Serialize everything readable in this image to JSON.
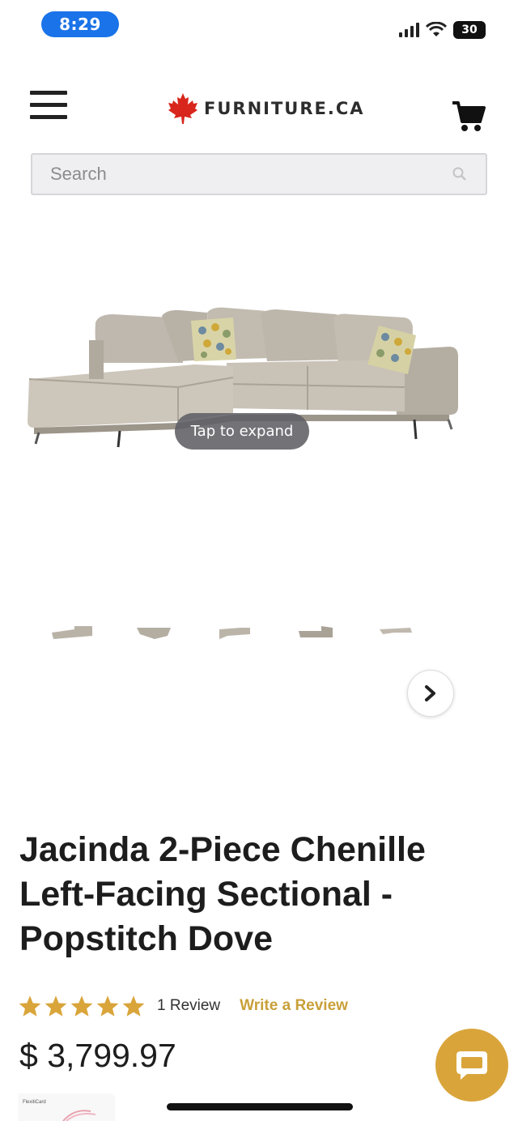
{
  "status_bar": {
    "time": "8:29",
    "battery": "30"
  },
  "header": {
    "brand_name": "FURNITURE.CA",
    "icons": [
      "menu-icon",
      "maple-leaf-icon",
      "cart-icon"
    ]
  },
  "search": {
    "placeholder": "Search",
    "icon": "search-icon"
  },
  "gallery": {
    "expand_label": "Tap to expand",
    "thumbnail_count": 5,
    "next_icon": "chevron-right-icon"
  },
  "product": {
    "title": "Jacinda 2-Piece Chenille Left-Facing Sectional - Popstitch Dove",
    "rating": 5,
    "max_rating": 5,
    "review_count": "1 Review",
    "write_review_label": "Write a Review",
    "price": "$ 3,799.97"
  },
  "card_promo": {
    "label": "FlexitiCard"
  },
  "colors": {
    "accent_gold": "#d9a53b",
    "star_gold": "#d9a53b",
    "link_gold": "#c9a03a",
    "time_pill_blue": "#1a73e8",
    "brand_red": "#d8261c"
  }
}
